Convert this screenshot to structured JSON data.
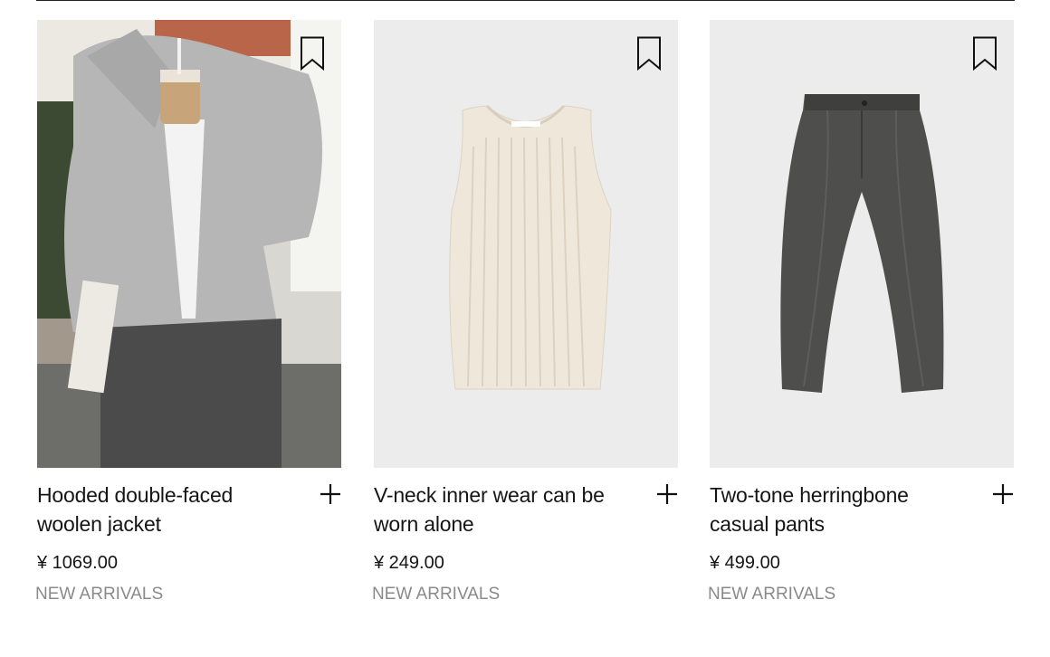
{
  "products": [
    {
      "title": "Hooded double-faced woolen jacket",
      "price": "¥ 1069.00",
      "tag": "NEW ARRIVALS",
      "image": "model-wearing-grey-jacket",
      "bookmark_icon": "bookmark-icon",
      "add_icon": "plus-icon"
    },
    {
      "title": "V-neck inner wear can be worn alone",
      "price": "¥ 249.00",
      "tag": "NEW ARRIVALS",
      "image": "cream-ribbed-tank-top",
      "bookmark_icon": "bookmark-icon",
      "add_icon": "plus-icon"
    },
    {
      "title": "Two-tone herringbone casual pants",
      "price": "¥ 499.00",
      "tag": "NEW ARRIVALS",
      "image": "grey-herringbone-pants",
      "bookmark_icon": "bookmark-icon",
      "add_icon": "plus-icon"
    }
  ],
  "colors": {
    "image_bg": "#ececec",
    "text": "#151515",
    "tag": "#8a8a8a"
  }
}
